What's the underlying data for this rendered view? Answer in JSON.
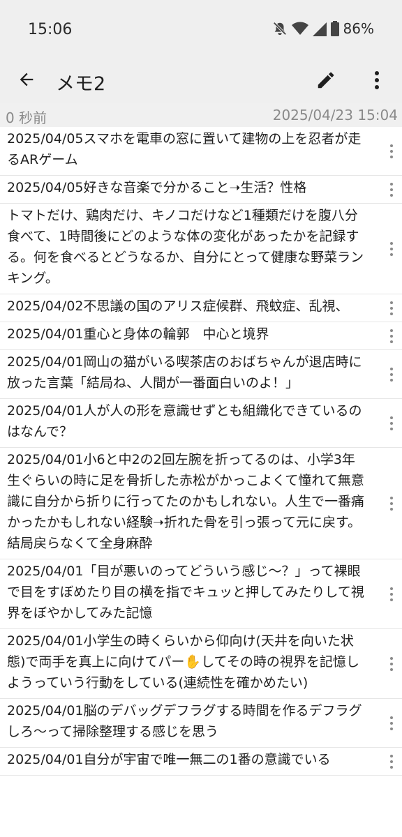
{
  "status_bar": {
    "time": "15:06",
    "battery_percent": "86%",
    "icons": [
      "mute-icon",
      "wifi-icon",
      "signal-icon",
      "battery-icon"
    ]
  },
  "app_bar": {
    "title": "メモ2",
    "back_icon": "back-arrow-icon",
    "edit_icon": "pencil-icon",
    "menu_icon": "more-vert-icon"
  },
  "meta": {
    "elapsed": "0 秒前",
    "datetime": "2025/04/23 15:04"
  },
  "memos": [
    {
      "text": "2025/04/05スマホを電車の窓に置いて建物の上を忍者が走るARゲーム"
    },
    {
      "text": "2025/04/05好きな音楽で分かること➝生活？性格"
    },
    {
      "text": "トマトだけ、鶏肉だけ、キノコだけなど1種類だけを腹八分食べて、1時間後にどのような体の変化があったかを記録する。何を食べるとどうなるか、自分にとって健康な野菜ランキング。"
    },
    {
      "text": "2025/04/02不思議の国のアリス症候群、飛蚊症、乱視、"
    },
    {
      "text": "2025/04/01重心と身体の輪郭　中心と境界"
    },
    {
      "text": "2025/04/01岡山の猫がいる喫茶店のおばちゃんが退店時に放った言葉「結局ね、人間が一番面白いのよ！」"
    },
    {
      "text": "2025/04/01人が人の形を意識せずとも組織化できているのはなんで？"
    },
    {
      "text": "2025/04/01小6と中2の2回左腕を折ってるのは、小学3年生ぐらいの時に足を骨折した赤松がかっこよくて憧れて無意識に自分から折りに行ってたのかもしれない。人生で一番痛かったかもしれない経験➝折れた骨を引っ張って元に戻す。結局戻らなくて全身麻酔"
    },
    {
      "text": "2025/04/01「目が悪いのってどういう感じ～？」って裸眼で目をすぼめたり目の横を指でキュッと押してみたりして視界をぼやかしてみた記憶"
    },
    {
      "text": "2025/04/01小学生の時くらいから仰向け(天井を向いた状態)で両手を真上に向けてパー✋してその時の視界を記憶しようっていう行動をしている(連続性を確かめたい)"
    },
    {
      "text": "2025/04/01脳のデバッグデフラグする時間を作るデフラグしろ～って掃除整理する感じを思う"
    },
    {
      "text": "2025/04/01自分が宇宙で唯一無二の1番の意識でいる"
    }
  ]
}
